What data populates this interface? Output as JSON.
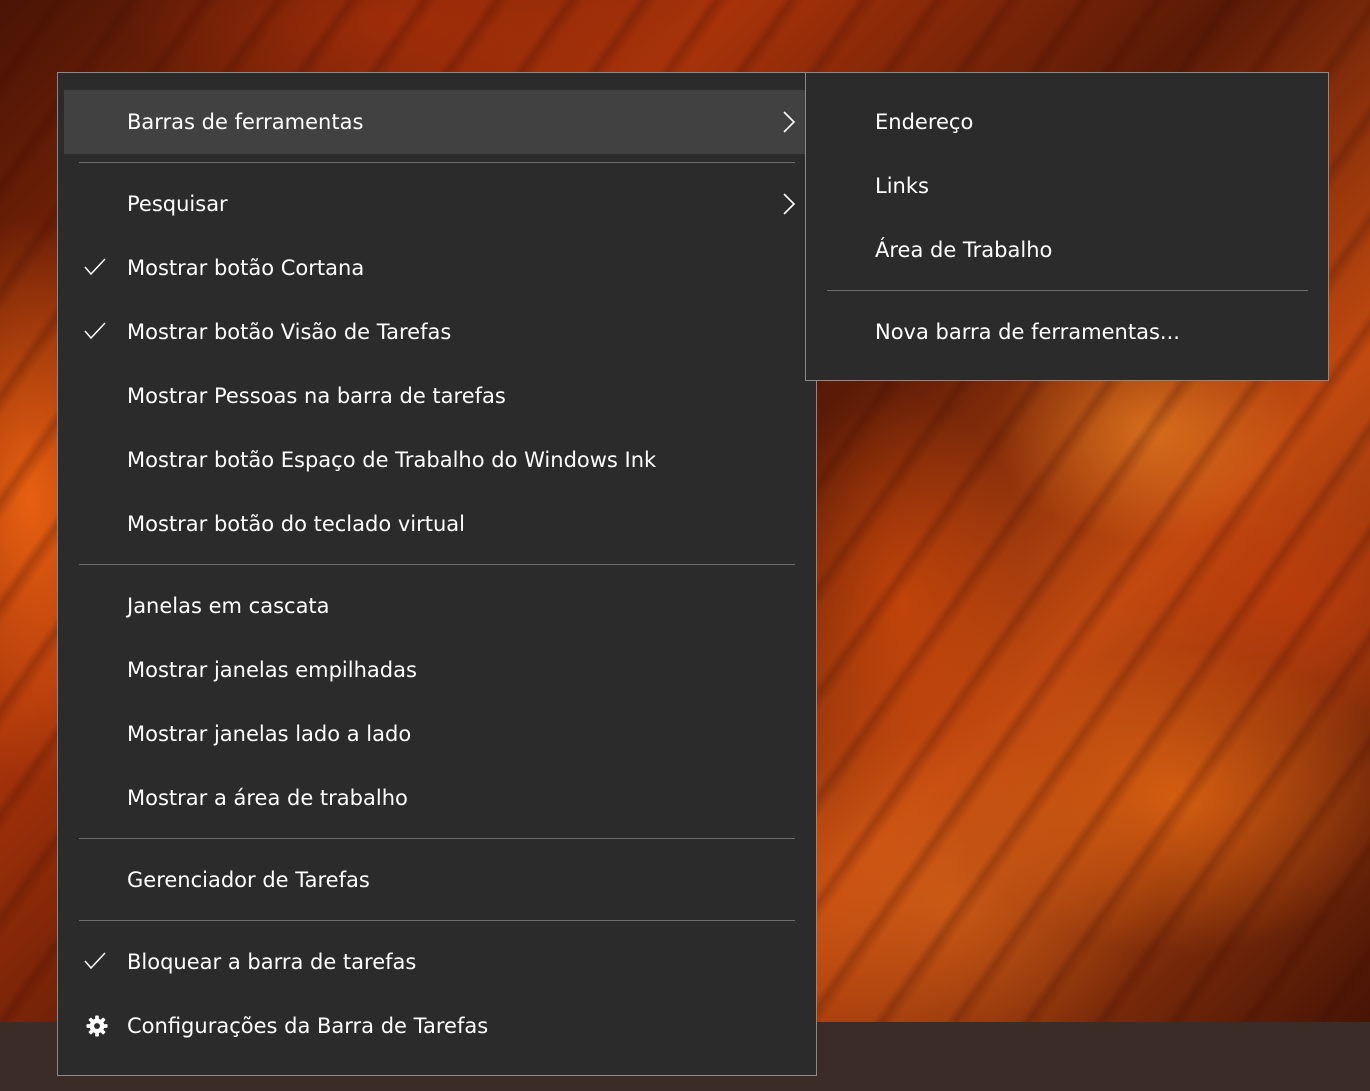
{
  "main_menu": {
    "toolbars": "Barras de ferramentas",
    "search": "Pesquisar",
    "show_cortana": "Mostrar botão Cortana",
    "show_task_view": "Mostrar botão Visão de Tarefas",
    "show_people": "Mostrar Pessoas na barra de tarefas",
    "show_ink_workspace": "Mostrar botão Espaço de Trabalho do Windows Ink",
    "show_touch_keyboard": "Mostrar botão do teclado virtual",
    "cascade_windows": "Janelas em cascata",
    "show_stacked": "Mostrar janelas empilhadas",
    "show_side_by_side": "Mostrar janelas lado a lado",
    "show_desktop": "Mostrar a área de trabalho",
    "task_manager": "Gerenciador de Tarefas",
    "lock_taskbar": "Bloquear a barra de tarefas",
    "taskbar_settings": "Configurações da Barra de Tarefas"
  },
  "sub_menu": {
    "address": "Endereço",
    "links": "Links",
    "desktop": "Área de Trabalho",
    "new_toolbar": "Nova barra de ferramentas..."
  },
  "icons": {
    "check": "checkmark-icon",
    "gear": "gear-icon",
    "chevron": "chevron-right-icon"
  },
  "colors": {
    "menu_background": "#2b2b2b",
    "highlight": "#414141",
    "separator": "#6d6d6d",
    "text": "#ffffff"
  }
}
